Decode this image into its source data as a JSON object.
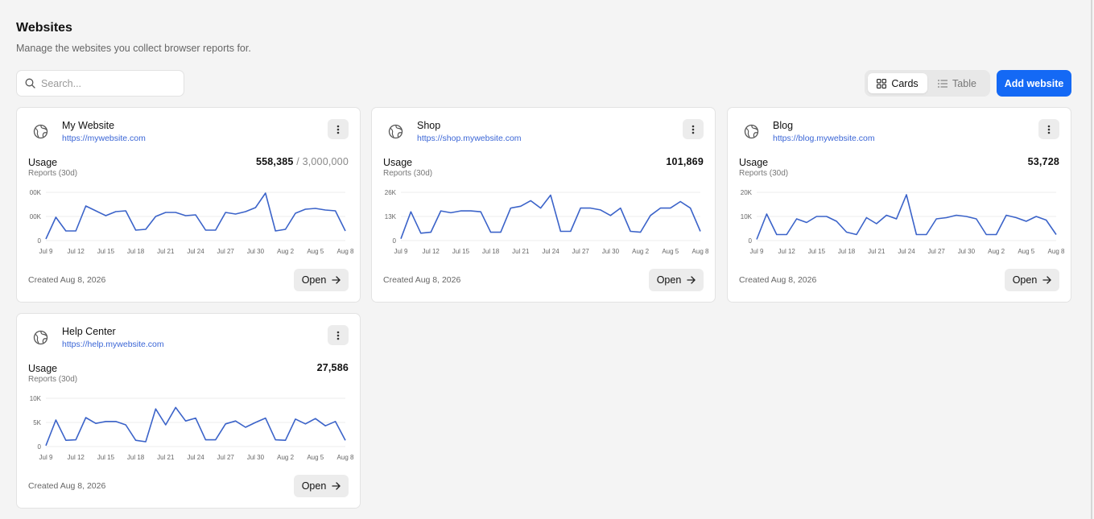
{
  "header": {
    "title": "Websites",
    "subtitle": "Manage the websites you collect browser reports for."
  },
  "search": {
    "placeholder": "Search...",
    "value": ""
  },
  "view_toggle": {
    "cards_label": "Cards",
    "table_label": "Table",
    "active": "Cards"
  },
  "add_button_label": "Add website",
  "icons": {
    "search": "search-icon",
    "cards": "grid-icon",
    "table": "list-icon",
    "site": "globe-icon",
    "menu": "more-vertical-icon",
    "open": "arrow-right-icon"
  },
  "colors": {
    "accent": "#1469f5",
    "line": "#3b63c9",
    "url": "#3b66d6"
  },
  "cards": [
    {
      "name": "My Website",
      "url": "https://mywebsite.com",
      "usage_label": "Usage",
      "usage_sub": "Reports (30d)",
      "usage_value": "558,385",
      "usage_limit": " / 3,000,000",
      "created": "Created Aug 8, 2026",
      "open_label": "Open",
      "y_ticks": [
        "00K",
        "00K",
        "0"
      ],
      "y_max": 60,
      "x_ticks": [
        "Jul 9",
        "Jul 12",
        "Jul 15",
        "Jul 18",
        "Jul 21",
        "Jul 24",
        "Jul 27",
        "Jul 30",
        "Aug 2",
        "Aug 5",
        "Aug 8"
      ],
      "values": [
        2,
        29,
        12,
        12,
        43,
        37,
        31,
        36,
        37,
        13,
        14,
        30,
        35,
        35,
        31,
        32,
        13,
        13,
        35,
        33,
        36,
        41,
        59,
        12,
        14,
        34,
        39,
        40,
        38,
        37,
        12
      ]
    },
    {
      "name": "Shop",
      "url": "https://shop.mywebsite.com",
      "usage_label": "Usage",
      "usage_sub": "Reports (30d)",
      "usage_value": "101,869",
      "usage_limit": "",
      "created": "Created Aug 8, 2026",
      "open_label": "Open",
      "y_ticks": [
        "26K",
        "13K",
        "0"
      ],
      "y_max": 26,
      "x_ticks": [
        "Jul 9",
        "Jul 12",
        "Jul 15",
        "Jul 18",
        "Jul 21",
        "Jul 24",
        "Jul 27",
        "Jul 30",
        "Aug 2",
        "Aug 5",
        "Aug 8"
      ],
      "values": [
        1,
        15.5,
        4,
        4.5,
        16,
        15,
        16,
        16,
        15.5,
        4.5,
        4.5,
        17.5,
        18.5,
        21.5,
        17.5,
        24.5,
        5,
        5,
        17.5,
        17.5,
        16.5,
        13.5,
        17.5,
        5,
        4.5,
        13.5,
        17.5,
        17.5,
        21,
        17.5,
        5
      ]
    },
    {
      "name": "Blog",
      "url": "https://blog.mywebsite.com",
      "usage_label": "Usage",
      "usage_sub": "Reports (30d)",
      "usage_value": "53,728",
      "usage_limit": "",
      "created": "Created Aug 8, 2026",
      "open_label": "Open",
      "y_ticks": [
        "20K",
        "10K",
        "0"
      ],
      "y_max": 20,
      "x_ticks": [
        "Jul 9",
        "Jul 12",
        "Jul 15",
        "Jul 18",
        "Jul 21",
        "Jul 24",
        "Jul 27",
        "Jul 30",
        "Aug 2",
        "Aug 5",
        "Aug 8"
      ],
      "values": [
        0.5,
        11,
        2.5,
        2.5,
        9,
        7.5,
        10,
        10,
        8,
        3.5,
        2.5,
        9.5,
        7,
        10.5,
        9,
        19,
        2.5,
        2.5,
        9,
        9.5,
        10.5,
        10,
        9,
        2.5,
        2.5,
        10.5,
        9.5,
        8,
        10,
        8.5,
        2.5
      ]
    },
    {
      "name": "Help Center",
      "url": "https://help.mywebsite.com",
      "usage_label": "Usage",
      "usage_sub": "Reports (30d)",
      "usage_value": "27,586",
      "usage_limit": "",
      "created": "Created Aug 8, 2026",
      "open_label": "Open",
      "y_ticks": [
        "10K",
        "5K",
        "0"
      ],
      "y_max": 10,
      "x_ticks": [
        "Jul 9",
        "Jul 12",
        "Jul 15",
        "Jul 18",
        "Jul 21",
        "Jul 24",
        "Jul 27",
        "Jul 30",
        "Aug 2",
        "Aug 5",
        "Aug 8"
      ],
      "values": [
        0.2,
        5.5,
        1.3,
        1.4,
        6,
        4.8,
        5.2,
        5.2,
        4.5,
        1.3,
        1,
        7.8,
        4.5,
        8.1,
        5.3,
        5.9,
        1.4,
        1.4,
        4.7,
        5.3,
        4,
        5,
        5.9,
        1.4,
        1.3,
        5.7,
        4.7,
        5.8,
        4.3,
        5.2,
        1.3
      ]
    }
  ]
}
